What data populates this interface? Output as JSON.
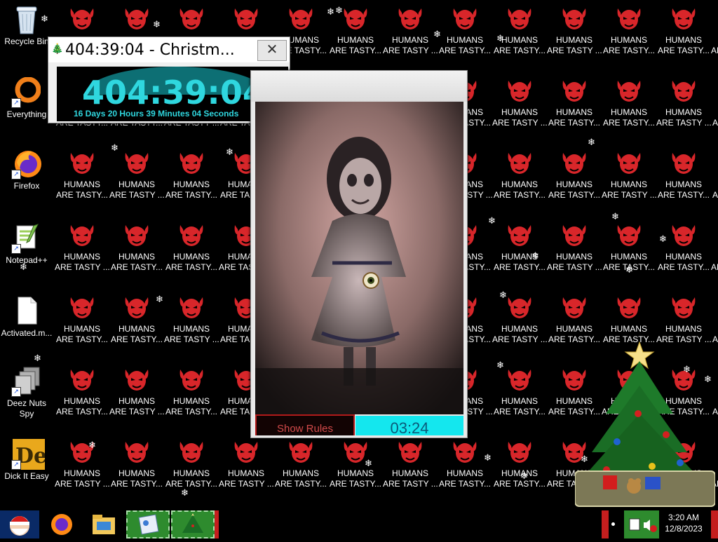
{
  "wallpaper": {
    "tile_line1": "HUMANS",
    "tile_line2": "ARE TASTY...",
    "tile_line2_alt": "ARE TASTY ...",
    "demon_color": "#d8262a"
  },
  "desktop_icons": [
    {
      "label": "Recycle Bin",
      "icon": "recycle-bin-icon"
    },
    {
      "label": "Everything",
      "icon": "everything-icon"
    },
    {
      "label": "Firefox",
      "icon": "firefox-icon"
    },
    {
      "label": "Notepad++",
      "icon": "notepad-plus-plus-icon"
    },
    {
      "label": "Activated.m...",
      "icon": "file-icon"
    },
    {
      "label": "Deez Nuts Spy",
      "icon": "deez-nuts-spy-icon"
    },
    {
      "label": "Dick It Easy",
      "icon": "dick-it-easy-icon"
    }
  ],
  "countdown_window": {
    "title": "404:39:04 - Christm...",
    "close_glyph": "✕",
    "big_time": "404:39:04",
    "detail": "16 Days 20 Hours 39 Minutes 04 Seconds"
  },
  "game_window": {
    "show_rules_label": "Show Rules",
    "timer": "03:24"
  },
  "taskbar": {
    "clock_time": "3:20 AM",
    "clock_date": "12/8/2023"
  },
  "colors": {
    "countdown_cyan": "#2fd7df",
    "timer_bg": "#14e7ee",
    "rules_red": "#b11a1a",
    "taskbar_green": "#2e8b2e"
  }
}
